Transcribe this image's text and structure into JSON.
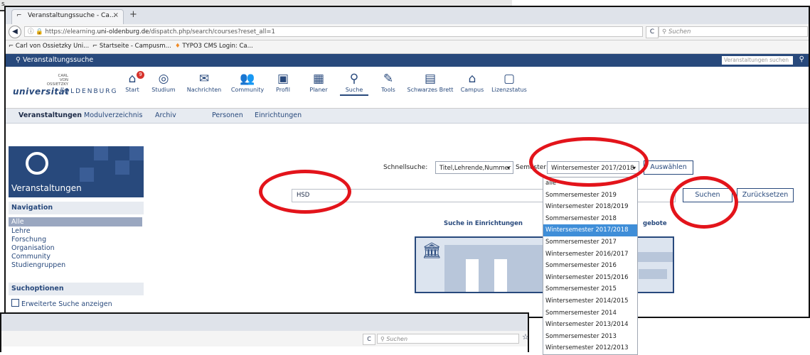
{
  "bg_top": {
    "fragment": "s"
  },
  "browser": {
    "tab_title": "Veranstaltungssuche - Ca...",
    "tab_close": "×",
    "new_tab": "+",
    "url_prefix": "https://elearning.",
    "url_domain": "uni-oldenburg.de",
    "url_path": "/dispatch.php/search/courses?reset_all=1",
    "search_placeholder": "Suchen",
    "bookmarks": [
      "Carl von Ossietzky Uni...",
      "Startseite - Campusm...",
      "TYPO3 CMS Login: Ca..."
    ]
  },
  "header": {
    "page_title": "Veranstaltungssuche",
    "search_placeholder": "Veranstaltungen suchen"
  },
  "logo": {
    "line1": "CARL",
    "line2": "VON",
    "line3": "OSSIETZKY",
    "uni": "universität",
    "city": "OLDENBURG"
  },
  "nav": [
    {
      "label": "Start",
      "icon": "home-icon",
      "glyph": "⌂",
      "badge": "9"
    },
    {
      "label": "Studium",
      "icon": "studium-icon",
      "glyph": "◎"
    },
    {
      "label": "Nachrichten",
      "icon": "mail-icon",
      "glyph": "✉"
    },
    {
      "label": "Community",
      "icon": "community-icon",
      "glyph": "👥"
    },
    {
      "label": "Profil",
      "icon": "profile-icon",
      "glyph": "▣"
    },
    {
      "label": "Planer",
      "icon": "calendar-icon",
      "glyph": "▦"
    },
    {
      "label": "Suche",
      "icon": "search-icon",
      "glyph": "⚲"
    },
    {
      "label": "Tools",
      "icon": "wrench-icon",
      "glyph": "✎"
    },
    {
      "label": "Schwarzes Brett",
      "icon": "board-icon",
      "glyph": "▤"
    },
    {
      "label": "Campus",
      "icon": "campus-icon",
      "glyph": "⌂"
    },
    {
      "label": "Lizenzstatus",
      "icon": "license-icon",
      "glyph": "▢"
    }
  ],
  "subtabs": [
    "Veranstaltungen",
    "Modulverzeichnis",
    "Archiv",
    "Personen",
    "Einrichtungen"
  ],
  "sidebar": {
    "box_title": "Veranstaltungen",
    "navigation_header": "Navigation",
    "nav_items": [
      "Alle",
      "Lehre",
      "Forschung",
      "Organisation",
      "Community",
      "Studiengruppen"
    ],
    "options_header": "Suchoptionen",
    "extended_search": "Erweiterte Suche anzeigen"
  },
  "search": {
    "quick_label": "Schnellsuche:",
    "quick_value": "Titel,Lehrende,Nummer",
    "semester_label": "Semester:",
    "semester_value": "Wintersemester 2017/2018",
    "select_button": "Auswählen",
    "query": "HSD",
    "search_button": "Suchen",
    "reset_button": "Zurücksetzen",
    "institutions_title": "Suche in Einrichtungen",
    "offers_title_fragment": "gebote"
  },
  "dropdown_options": [
    "alle",
    "Sommersemester 2019",
    "Wintersemester 2018/2019",
    "Sommersemester 2018",
    "Wintersemester 2017/2018",
    "Sommersemester 2017",
    "Wintersemester 2016/2017",
    "Sommersemester 2016",
    "Wintersemester 2015/2016",
    "Sommersemester 2015",
    "Wintersemester 2014/2015",
    "Sommersemester 2014",
    "Wintersemester 2013/2014",
    "Sommersemester 2013",
    "Wintersemester 2012/2013"
  ],
  "dropdown_selected_index": 4,
  "bg_bottom": {
    "search_placeholder": "Suchen"
  },
  "colors": {
    "brand": "#28497c",
    "highlight": "#3f8ed8",
    "annotation": "#e3141b"
  }
}
